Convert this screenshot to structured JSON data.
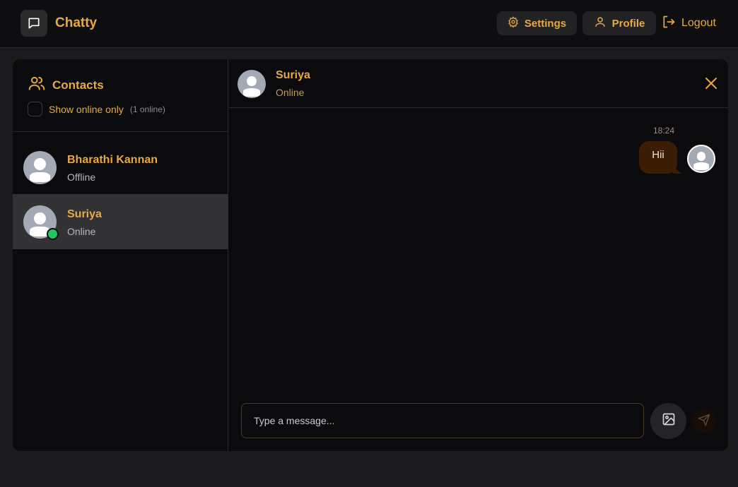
{
  "navbar": {
    "brand": "Chatty",
    "settings_label": "Settings",
    "profile_label": "Profile",
    "logout_label": "Logout"
  },
  "sidebar": {
    "title": "Contacts",
    "filter_label": "Show online only",
    "online_count": "(1 online)",
    "contacts": [
      {
        "name": "Bharathi Kannan",
        "status": "Offline"
      },
      {
        "name": "Suriya",
        "status": "Online"
      }
    ]
  },
  "chat": {
    "contact_name": "Suriya",
    "contact_status": "Online",
    "messages": [
      {
        "time": "18:24",
        "text": "Hii"
      }
    ],
    "input_placeholder": "Type a message..."
  },
  "colors": {
    "accent": "#e8a945",
    "online": "#22c55e",
    "bubble": "#3b1c05"
  },
  "icons": [
    "message-square-icon",
    "gear-icon",
    "user-icon",
    "logout-icon",
    "users-icon",
    "close-icon",
    "image-icon",
    "send-icon"
  ]
}
